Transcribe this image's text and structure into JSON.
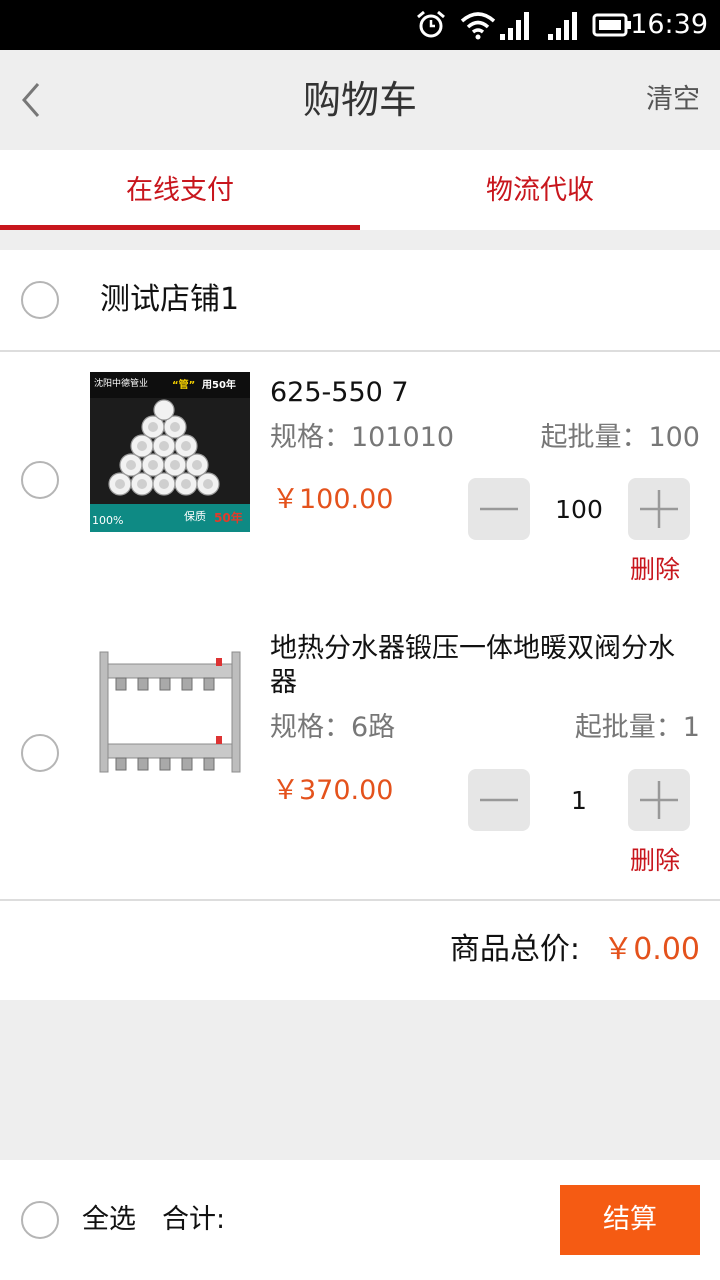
{
  "status_bar": {
    "time": "16:39",
    "icons": [
      "alarm-icon",
      "wifi-icon",
      "signal-icon",
      "signal-icon",
      "battery-icon"
    ]
  },
  "nav": {
    "title": "购物车",
    "clear_label": "清空",
    "back_icon": "chevron-left-icon"
  },
  "tabs": [
    {
      "label": "在线支付",
      "active": true
    },
    {
      "label": "物流代收",
      "active": false
    }
  ],
  "shop": {
    "name": "测试店铺1",
    "items": [
      {
        "name": "625-550 7",
        "spec": "规格：101010",
        "moq": "起批量：100",
        "price": "￥100.00",
        "quantity": "100",
        "delete_label": "删除",
        "image": {
          "brand": "沈阳中德管业",
          "slogan_prefix": "“管”",
          "slogan_suffix": "用50年",
          "tagline": "100%",
          "quality": "保质",
          "quality_years": "50年"
        }
      },
      {
        "name": "地热分水器锻压一体地暖双阀分水器",
        "spec": "规格：6路",
        "moq": "起批量：1",
        "price": "￥370.00",
        "quantity": "1",
        "delete_label": "删除"
      }
    ],
    "total_label": "商品总价:",
    "total_value": "￥0.00"
  },
  "bottom_bar": {
    "select_all_label": "全选",
    "sum_label": "合计:",
    "checkout_label": "结算"
  },
  "colors": {
    "accent_red": "#c8161d",
    "price_orange": "#e4521c",
    "checkout_orange": "#f55b13"
  }
}
